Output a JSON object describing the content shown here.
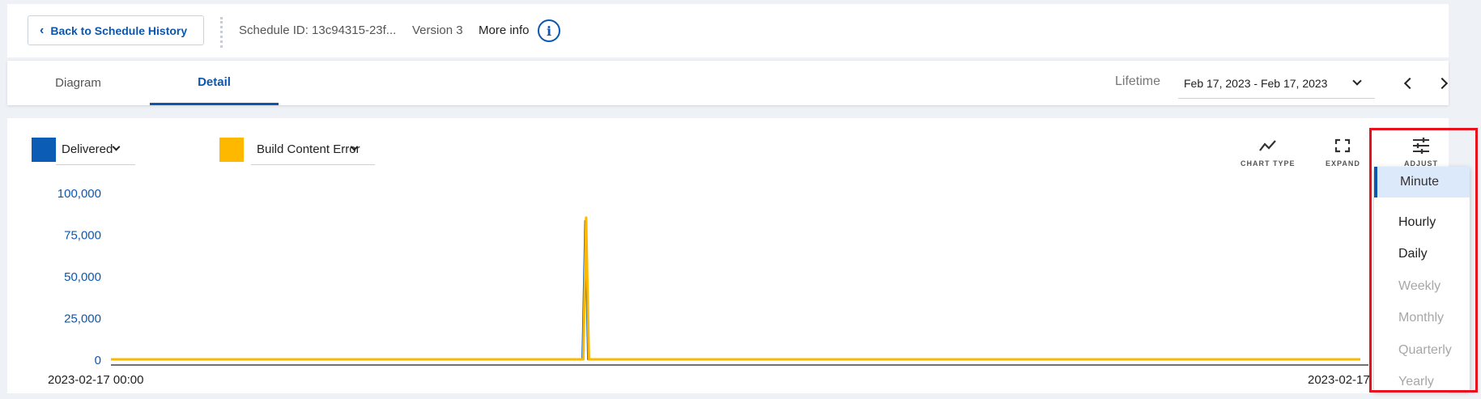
{
  "header": {
    "back_label": "Back to Schedule History",
    "schedule_id": "Schedule ID: 13c94315-23f...",
    "version": "Version 3",
    "more_info": "More info"
  },
  "tabs": [
    {
      "label": "Diagram",
      "active": false
    },
    {
      "label": "Detail",
      "active": true
    }
  ],
  "range": {
    "label": "Lifetime",
    "value": "Feb 17, 2023 - Feb 17, 2023"
  },
  "legend": [
    {
      "label": "Delivered",
      "color": "#0b5cb5"
    },
    {
      "label": "Build Content Error",
      "color": "#ffb800"
    }
  ],
  "toolbar": {
    "chart_type": "CHART TYPE",
    "expand": "EXPAND",
    "adjust": "ADJUST"
  },
  "granularity_menu": {
    "selected": "Minute",
    "items": [
      {
        "label": "Minute",
        "state": "selected"
      },
      {
        "label": "Hourly",
        "state": "enabled"
      },
      {
        "label": "Daily",
        "state": "enabled"
      },
      {
        "label": "Weekly",
        "state": "disabled"
      },
      {
        "label": "Monthly",
        "state": "disabled"
      },
      {
        "label": "Quarterly",
        "state": "disabled"
      },
      {
        "label": "Yearly",
        "state": "disabled"
      }
    ]
  },
  "chart_data": {
    "type": "area",
    "ylim": [
      0,
      100000
    ],
    "y_ticks": [
      0,
      25000,
      50000,
      75000,
      100000
    ],
    "y_tick_labels": [
      "0",
      "25,000",
      "50,000",
      "75,000",
      "100,000"
    ],
    "x_tick_labels": [
      "2023-02-17 00:00",
      "2023-02-17"
    ],
    "series": [
      {
        "name": "Delivered",
        "color": "#0b5cb5",
        "spike_position": 0.38,
        "peak": 83000
      },
      {
        "name": "Build Content Error",
        "color": "#ffb800",
        "spike_position": 0.38,
        "peak": 85000
      }
    ]
  }
}
